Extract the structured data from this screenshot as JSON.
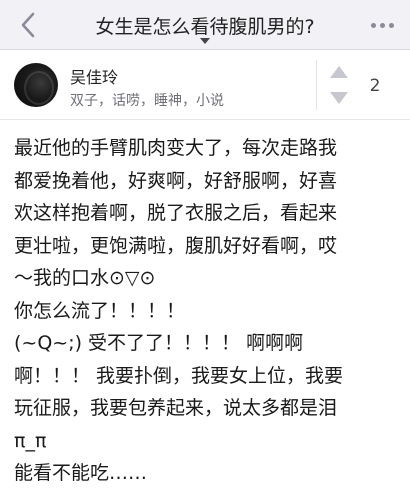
{
  "nav": {
    "title": "女生是怎么看待腹肌男的?"
  },
  "author": {
    "name": "吴佳玲",
    "bio": "双子，话唠，睡神，小说"
  },
  "vote": {
    "count": "2"
  },
  "answer": {
    "lines": [
      "最近他的手臂肌肉变大了，每次走路我",
      "都爱挽着他，好爽啊，好舒服啊，好喜",
      "欢这样抱着啊，脱了衣服之后，看起来",
      "更壮啦，更饱满啦，腹肌好好看啊，哎",
      "～我的口水⊙▽⊙",
      "你怎么流了！！！！",
      "(~Q~;) 受不了了！！！！ 啊啊啊",
      "啊！！！ 我要扑倒，我要女上位，我要",
      "玩征服，我要包养起来，说太多都是泪",
      "π_π",
      "能看不能吃……"
    ]
  }
}
